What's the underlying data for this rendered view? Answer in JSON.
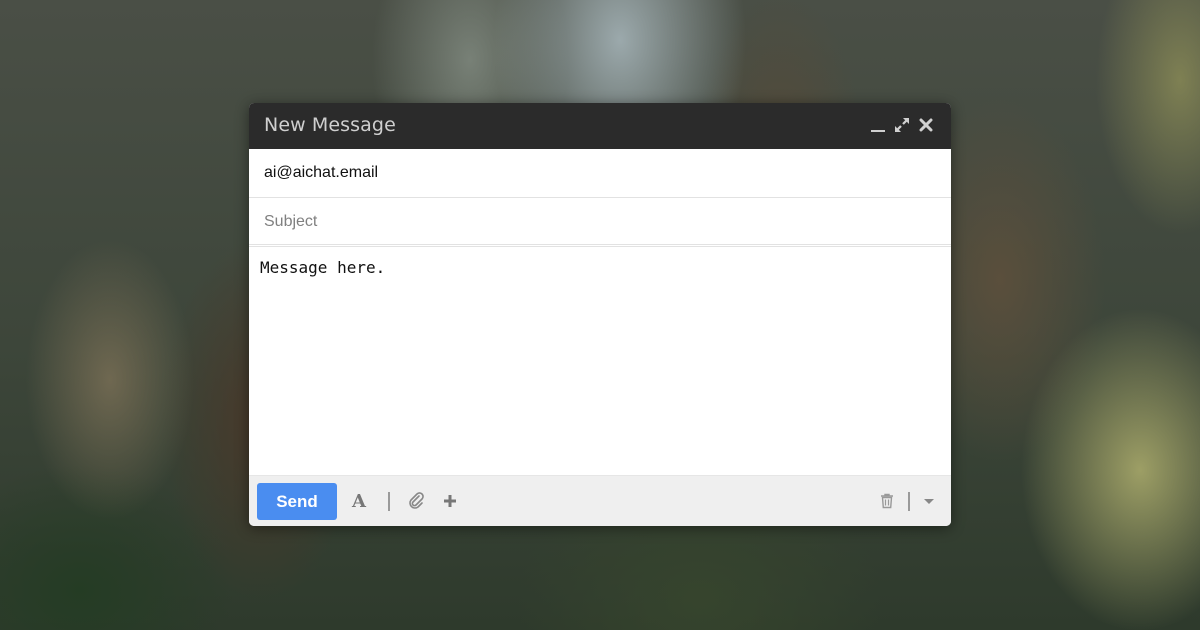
{
  "compose": {
    "title": "New Message",
    "to_value": "ai@aichat.email",
    "subject_placeholder": "Subject",
    "body_text": "Message here.",
    "send_label": "Send",
    "format_icon_glyph": "A"
  },
  "icons": {
    "titlebar": [
      "minimize-icon",
      "expand-icon",
      "close-icon"
    ],
    "footer": [
      "format-text-icon",
      "attach-icon",
      "more-insert-icon",
      "trash-icon",
      "more-options-icon"
    ]
  },
  "colors": {
    "titlebar_bg": "#2b2b2b",
    "send_button": "#4a8df0",
    "footer_bg": "#efefef"
  }
}
